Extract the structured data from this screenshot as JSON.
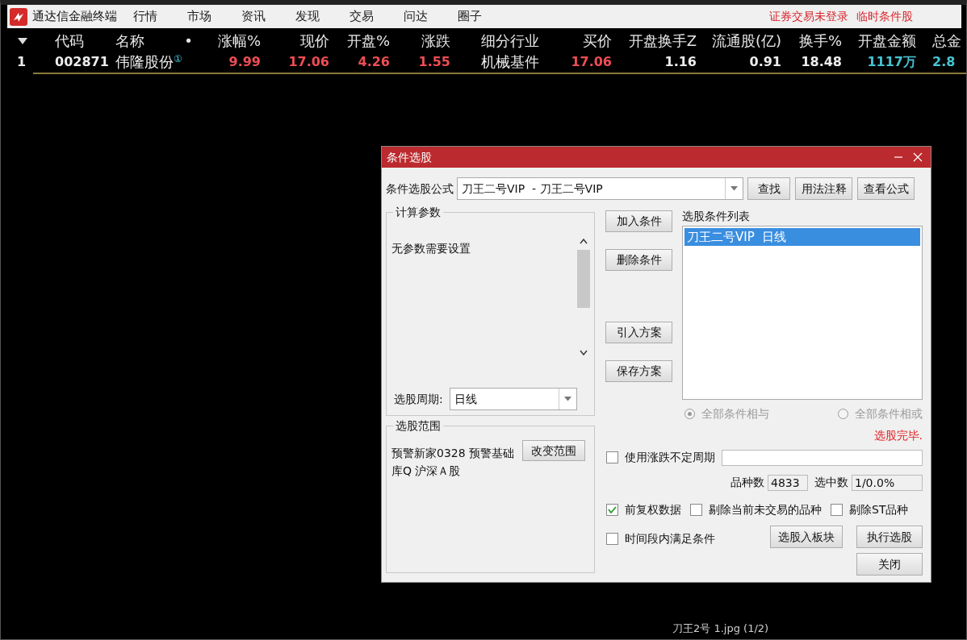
{
  "app": {
    "title": "通达信金融终端",
    "menu": [
      "行情",
      "市场",
      "资讯",
      "发现",
      "交易",
      "问达",
      "圈子"
    ],
    "status": [
      "证券交易未登录",
      "临时条件股"
    ]
  },
  "quote_table": {
    "columns": [
      "代码",
      "名称",
      "•",
      "涨幅%",
      "现价",
      "开盘%",
      "涨跌",
      "细分行业",
      "买价",
      "开盘换手Z",
      "流通股(亿)",
      "换手%",
      "开盘金额",
      "总金"
    ],
    "rows": [
      {
        "index": "1",
        "cells": [
          {
            "text": "002871",
            "color": "#ececec"
          },
          {
            "text": "伟隆股份",
            "color": "#ececec",
            "note": "①"
          },
          {
            "text": ""
          },
          {
            "text": "9.99",
            "color": "#ee4d55"
          },
          {
            "text": "17.06",
            "color": "#ee4d55"
          },
          {
            "text": "4.26",
            "color": "#ee4d55"
          },
          {
            "text": "1.55",
            "color": "#ee4d55"
          },
          {
            "text": "机械基件",
            "color": "#ececec"
          },
          {
            "text": "17.06",
            "color": "#ee4d55"
          },
          {
            "text": "1.16",
            "color": "#ececec"
          },
          {
            "text": "0.91",
            "color": "#ececec"
          },
          {
            "text": "18.48",
            "color": "#ececec"
          },
          {
            "text": "1117万",
            "color": "#45c4d4"
          },
          {
            "text": "2.8",
            "color": "#45c4d4"
          }
        ]
      }
    ]
  },
  "dialog": {
    "title": "条件选股",
    "formula_label": "条件选股公式",
    "formula_value": "刀王二号VIP  - 刀王二号VIP",
    "top_buttons": [
      "查找",
      "用法注释",
      "查看公式"
    ],
    "params": {
      "title": "计算参数",
      "text": "无参数需要设置",
      "period_label": "选股周期:",
      "period_value": "日线"
    },
    "middle_buttons": [
      "加入条件",
      "删除条件",
      "引入方案",
      "保存方案"
    ],
    "conditions": {
      "title": "选股条件列表",
      "items": [
        {
          "label": "刀王二号VIP  日线",
          "selected": true
        }
      ]
    },
    "combine": {
      "disabled": true,
      "options": [
        {
          "label": "全部条件相与",
          "selected": true
        },
        {
          "label": "全部条件相或",
          "selected": false
        }
      ]
    },
    "result": "选股完毕.",
    "range": {
      "title": "选股范围",
      "text": "预警新家0328 预警基础库Q 沪深Ａ股",
      "button": "改变范围"
    },
    "variable_period": {
      "label": "使用涨跌不定周期",
      "checked": false
    },
    "count_label": "品种数",
    "count_value": "4833",
    "selected_label": "选中数",
    "selected_value": "1/0.0%",
    "options": [
      {
        "label": "前复权数据",
        "checked": true
      },
      {
        "label": "剔除当前未交易的品种",
        "checked": false
      },
      {
        "label": "剔除ST品种",
        "checked": false
      }
    ],
    "time_range": {
      "label": "时间段内满足条件",
      "checked": false
    },
    "action_buttons": [
      "选股入板块",
      "执行选股",
      "关闭"
    ]
  },
  "caption": "刀王2号 1.jpg (1/2)"
}
